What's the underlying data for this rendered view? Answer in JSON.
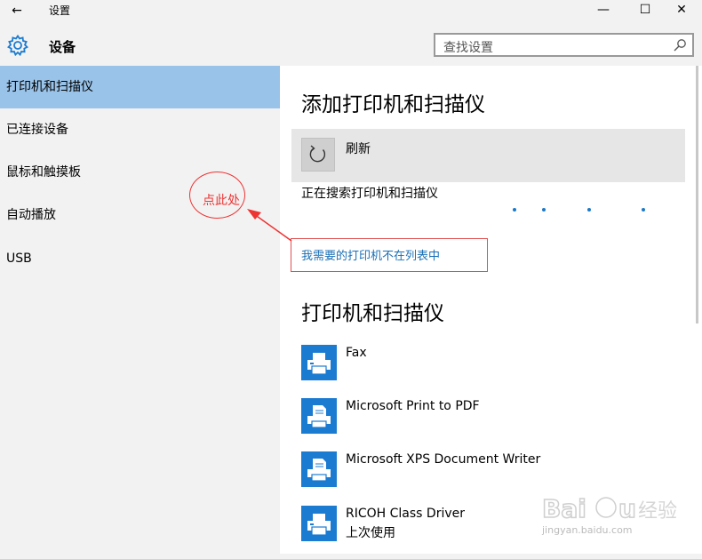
{
  "window": {
    "title": "设置",
    "back_glyph": "←",
    "minimize_glyph": "—",
    "maximize_glyph": "☐",
    "close_glyph": "✕"
  },
  "header": {
    "section_title": "设备",
    "search_placeholder": "查找设置"
  },
  "sidebar": {
    "items": [
      {
        "label": "打印机和扫描仪",
        "active": true
      },
      {
        "label": "已连接设备"
      },
      {
        "label": "鼠标和触摸板"
      },
      {
        "label": "自动播放"
      },
      {
        "label": "USB"
      }
    ]
  },
  "main": {
    "add_heading": "添加打印机和扫描仪",
    "refresh_label": "刷新",
    "searching_text": "正在搜索打印机和扫描仪",
    "not_listed_link": "我需要的打印机不在列表中",
    "list_heading": "打印机和扫描仪",
    "devices": [
      {
        "name": "Fax",
        "sub": ""
      },
      {
        "name": "Microsoft Print to PDF",
        "sub": ""
      },
      {
        "name": "Microsoft XPS Document Writer",
        "sub": ""
      },
      {
        "name": "RICOH Class Driver",
        "sub": "上次使用"
      }
    ]
  },
  "annotation": {
    "text": "点此处",
    "color": "#e33333"
  },
  "watermark": {
    "brand": "Baidu经验",
    "url": "jingyan.baidu.com"
  },
  "colors": {
    "accent": "#1b7bd1",
    "sidebar_active": "#99c3e9"
  }
}
